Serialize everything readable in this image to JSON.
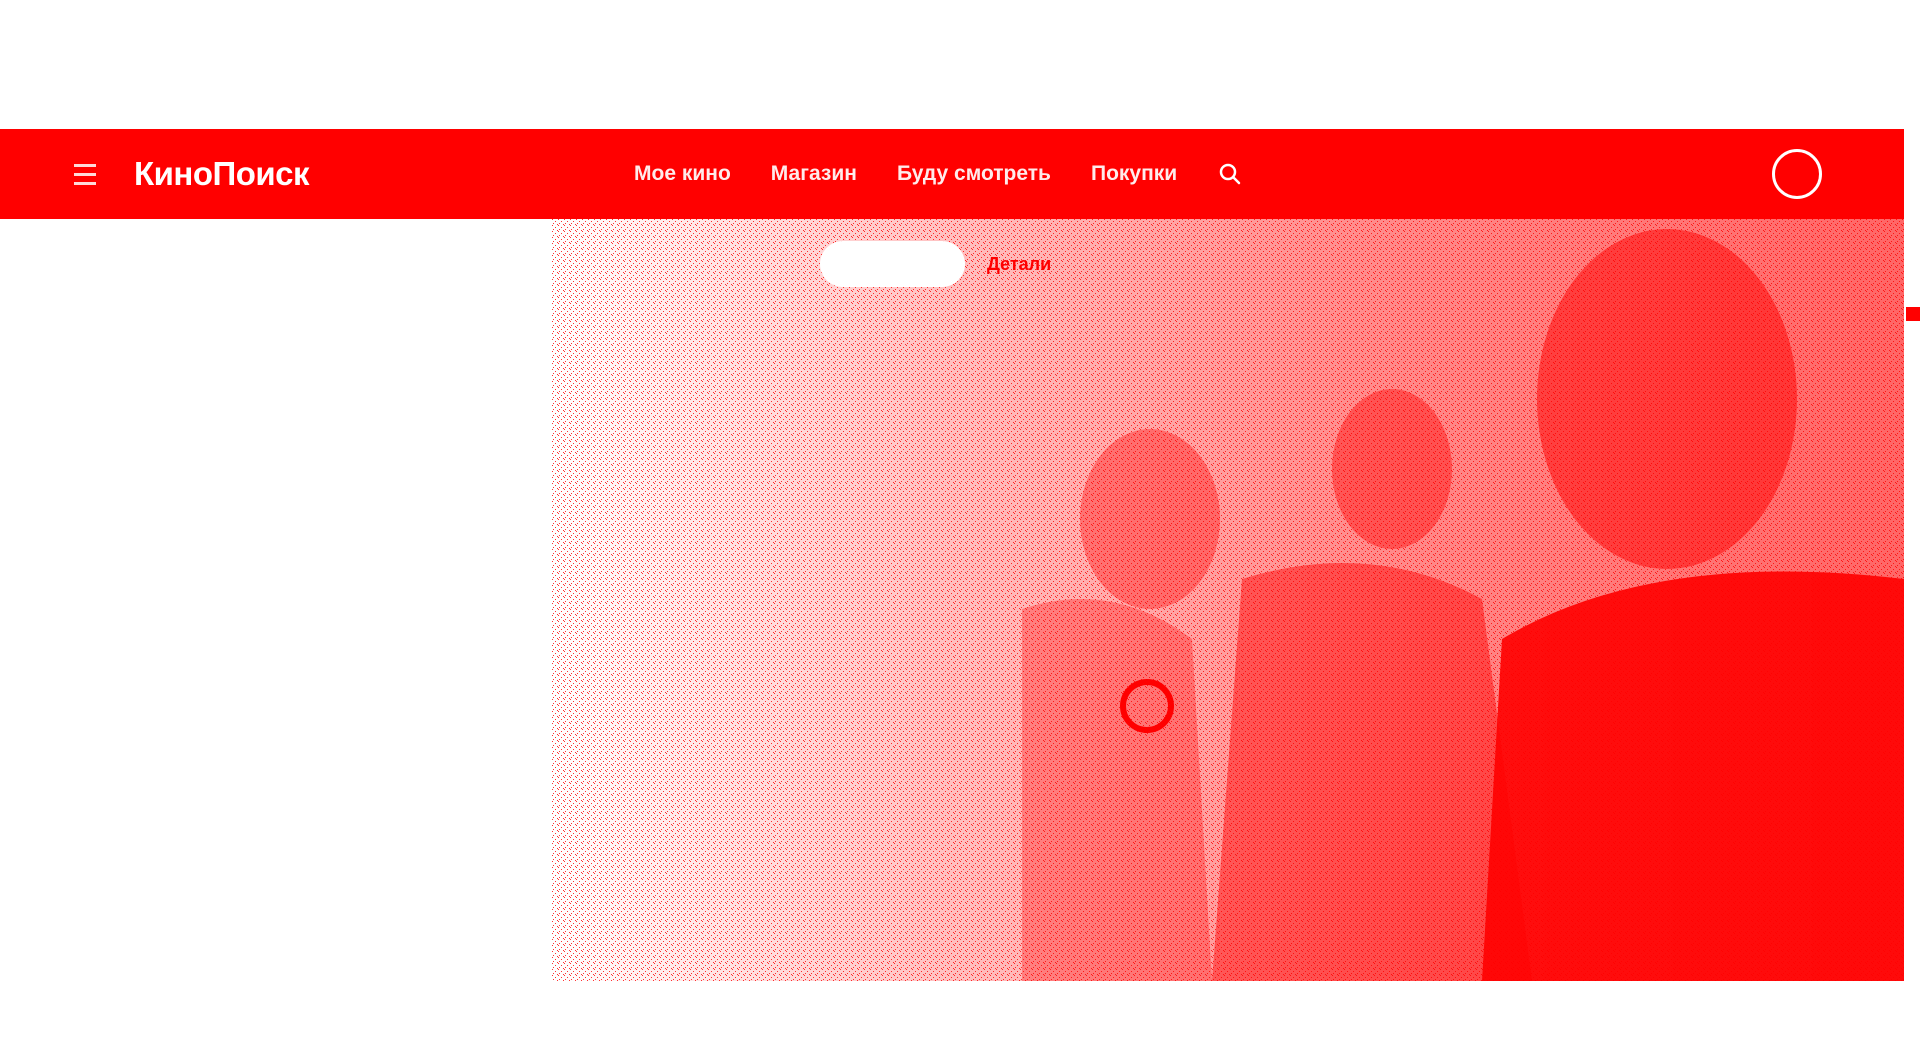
{
  "header": {
    "logo": "КиноПоиск",
    "nav": [
      {
        "label": "Мое кино"
      },
      {
        "label": "Магазин"
      },
      {
        "label": "Буду смотреть"
      },
      {
        "label": "Покупки"
      }
    ],
    "search_icon": "search-icon",
    "avatar_icon": "avatar"
  },
  "hero": {
    "details_label": "Детали"
  },
  "colors": {
    "brand": "#ff0000",
    "background": "#ffffff",
    "text_on_brand": "#ffffff"
  }
}
